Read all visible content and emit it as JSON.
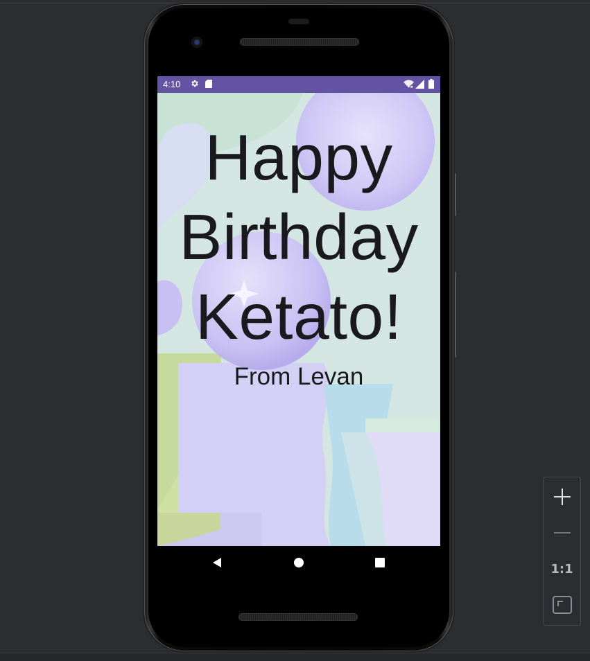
{
  "status_bar": {
    "time": "4:10",
    "background_color": "#6354a3",
    "icons": [
      "gear-icon",
      "sd-card-icon",
      "wifi-off-icon",
      "signal-icon",
      "battery-icon"
    ]
  },
  "card": {
    "greeting": "Happy Birthday Ketato!",
    "signature": "From Levan"
  },
  "nav_bar": {
    "buttons": [
      "back-icon",
      "home-icon",
      "recents-icon"
    ]
  },
  "zoom_controls": {
    "zoom_in_icon": "plus-icon",
    "zoom_out_icon": "minus-icon",
    "actual_size_label": "1:1",
    "fit_screen_icon": "fit-screen-icon"
  },
  "colors": {
    "ide_background": "#2b2d30",
    "text": "#1a1a1e",
    "accent_purple": "#6354a3"
  }
}
